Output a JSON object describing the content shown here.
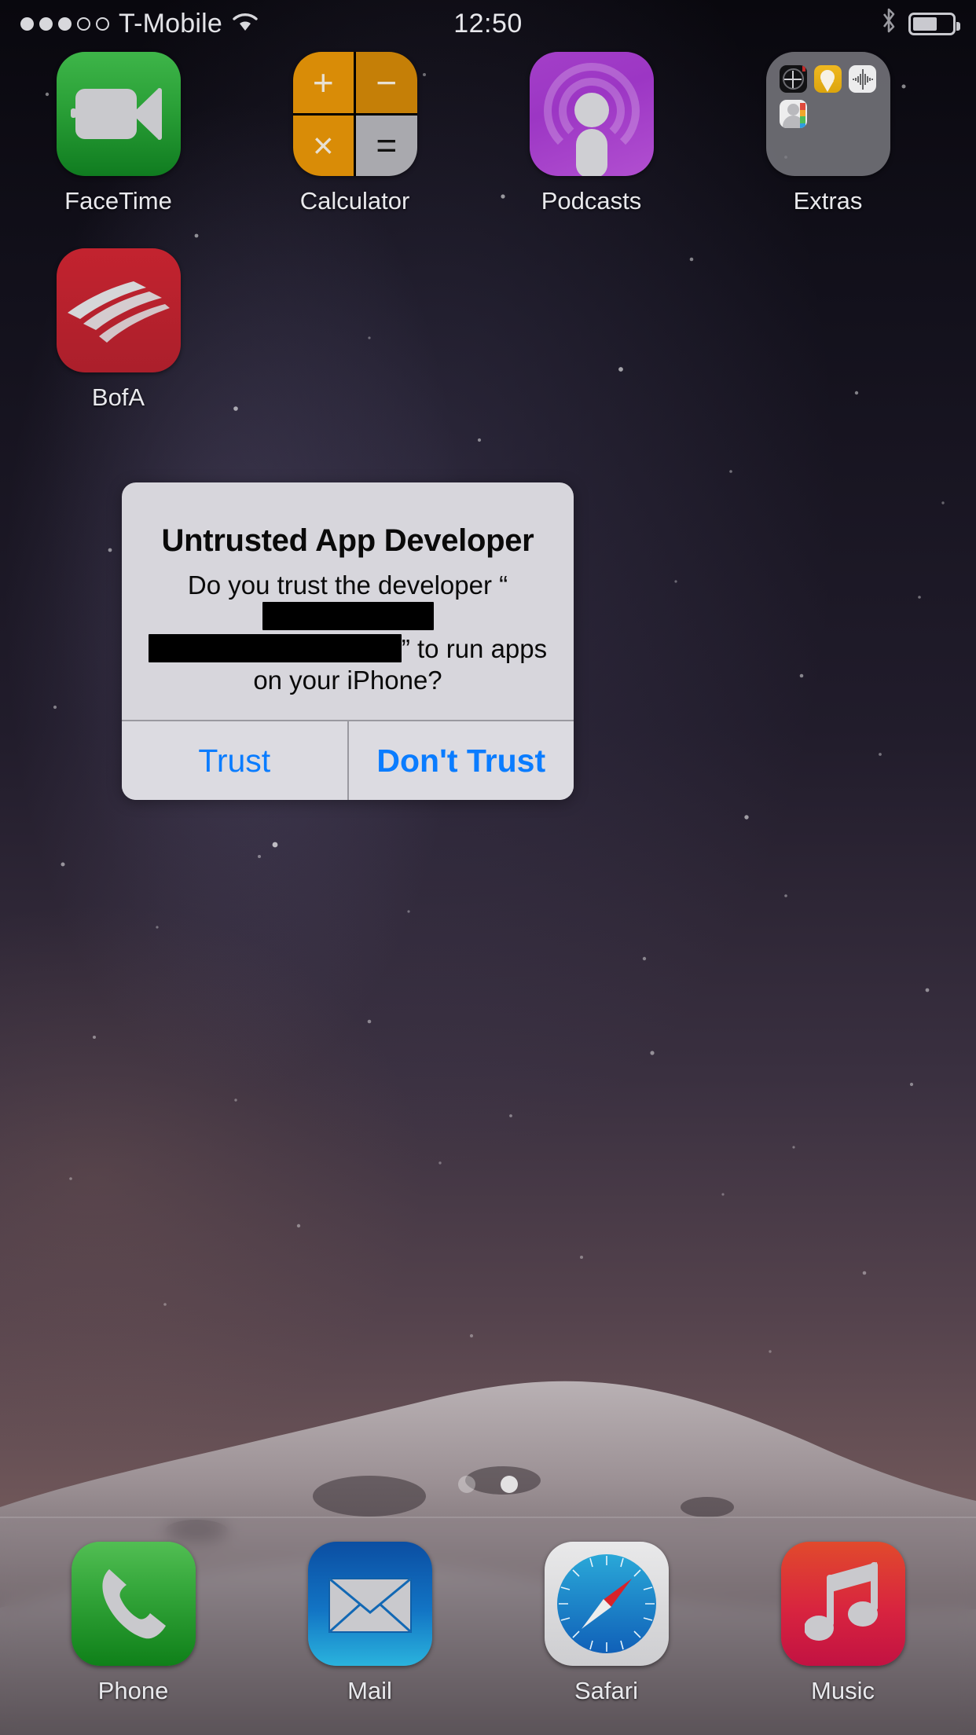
{
  "status_bar": {
    "carrier": "T-Mobile",
    "time": "12:50",
    "signal_bars_filled": 3,
    "signal_bars_total": 5,
    "wifi_icon": "wifi-icon",
    "bluetooth_icon": "bluetooth-icon",
    "battery_icon": "battery-icon",
    "battery_fill_percent": 62
  },
  "home_screen": {
    "rows": [
      [
        {
          "label": "FaceTime",
          "icon": "facetime-icon",
          "color": "#2aa037"
        },
        {
          "label": "Calculator",
          "icon": "calculator-icon",
          "color": "#d98c07"
        },
        {
          "label": "Podcasts",
          "icon": "podcasts-icon",
          "color": "#9c36c4"
        },
        {
          "label": "Extras",
          "icon": "folder-icon",
          "color": "#7c7c82"
        }
      ],
      [
        {
          "label": "BofA",
          "icon": "bank-of-america-icon",
          "color": "#b52632"
        }
      ]
    ],
    "folder_extras_apps": [
      "Compass",
      "Tips",
      "Voice Memos",
      "Contacts"
    ],
    "page_dots": {
      "total": 2,
      "active_index": 1
    }
  },
  "dock": {
    "apps": [
      {
        "label": "Phone",
        "icon": "phone-icon",
        "color": "#37a93d"
      },
      {
        "label": "Mail",
        "icon": "mail-icon",
        "color": "#1274c4"
      },
      {
        "label": "Safari",
        "icon": "safari-compass-icon",
        "color": "#1f7fd0"
      },
      {
        "label": "Music",
        "icon": "music-note-icon",
        "color": "#d8243f"
      }
    ]
  },
  "alert": {
    "title": "Untrusted App Developer",
    "message_part_1": "Do you trust the developer “",
    "message_redacted_1": "",
    "message_redacted_2": "",
    "message_part_2": "” to run apps on your iPhone?",
    "buttons": [
      {
        "label": "Trust",
        "style": "regular",
        "color": "#0a7cff"
      },
      {
        "label": "Don't Trust",
        "style": "bold",
        "color": "#0a7cff"
      }
    ]
  }
}
